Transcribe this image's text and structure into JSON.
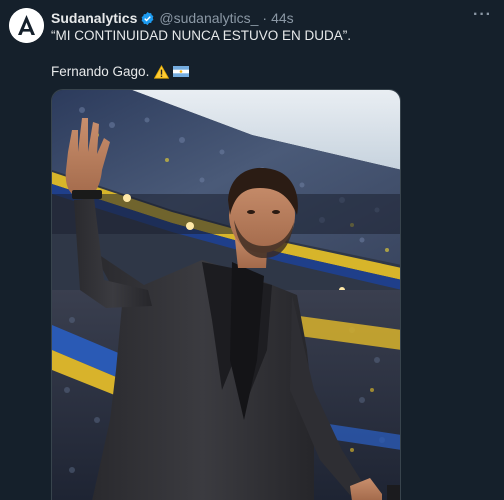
{
  "tweet": {
    "display_name": "Sudanalytics",
    "handle": "@sudanalytics_",
    "separator": "·",
    "time": "44s",
    "text_line1": "“MI CONTINUIDAD NUNCA ESTUVO EN DUDA”.",
    "text_line2": "Fernando Gago.",
    "more_label": "···"
  },
  "icons": {
    "avatar": "sudanalytics-logo-avatar",
    "verified": "verified-badge-icon",
    "more": "more-options-icon",
    "warning": "warning-emoji-icon",
    "flag": "argentina-flag-icon"
  },
  "colors": {
    "background": "#15202b",
    "text": "#e7e9ea",
    "secondary_text": "#8b98a5",
    "verified_blue": "#1d9bf0"
  }
}
